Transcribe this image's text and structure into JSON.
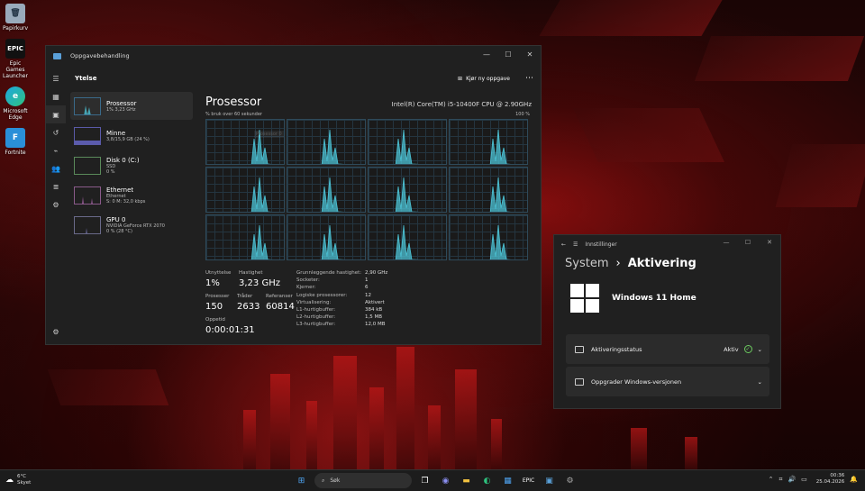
{
  "desktop": {
    "icons": [
      {
        "label": "Papirkurv"
      },
      {
        "label": "Epic Games Launcher"
      },
      {
        "label": "Microsoft Edge"
      },
      {
        "label": "Fortnite"
      }
    ]
  },
  "taskmanager": {
    "window_title": "Oppgavebehandling",
    "section": "Ytelse",
    "new_task": "Kjør ny oppgave",
    "list": [
      {
        "name": "Prosessor",
        "sub1": "1% 3,23 GHz",
        "sub2": ""
      },
      {
        "name": "Minne",
        "sub1": "3,8/15,9 GB (24 %)",
        "sub2": ""
      },
      {
        "name": "Disk 0 (C:)",
        "sub1": "SSD",
        "sub2": "0 %"
      },
      {
        "name": "Ethernet",
        "sub1": "Ethernet",
        "sub2": "S: 0 M: 32,0 kbps"
      },
      {
        "name": "GPU 0",
        "sub1": "NVIDIA GeForce RTX 2070",
        "sub2": "0 % (28 °C)"
      }
    ],
    "title": "Prosessor",
    "cpu_name": "Intel(R) Core(TM) i5-10400F CPU @ 2.90GHz",
    "usage_label": "% bruk over 60 sekunder",
    "usage_max": "100 %",
    "tooltip": "Prosessor 0",
    "stats": {
      "utilization_label": "Utnyttelse",
      "utilization": "1%",
      "speed_label": "Hastighet",
      "speed": "3,23 GHz",
      "processes_label": "Prosesser",
      "processes": "150",
      "threads_label": "Tråder",
      "threads": "2633",
      "handles_label": "Referanser",
      "handles": "60814",
      "uptime_label": "Oppetid",
      "uptime": "0:00:01:31"
    },
    "specs": [
      {
        "k": "Grunnleggende hastighet:",
        "v": "2,90 GHz"
      },
      {
        "k": "Socketer:",
        "v": "1"
      },
      {
        "k": "Kjerner:",
        "v": "6"
      },
      {
        "k": "Logiske prosessorer:",
        "v": "12"
      },
      {
        "k": "Virtualisering:",
        "v": "Aktivert"
      },
      {
        "k": "L1-hurtigbuffer:",
        "v": "384 kB"
      },
      {
        "k": "L2-hurtigbuffer:",
        "v": "1,5 MB"
      },
      {
        "k": "L3-hurtigbuffer:",
        "v": "12,0 MB"
      }
    ]
  },
  "settings": {
    "window_title": "Innstillinger",
    "crumb_root": "System",
    "crumb_sep": "›",
    "crumb_page": "Aktivering",
    "edition": "Windows 11 Home",
    "status_label": "Aktiveringsstatus",
    "status_value": "Aktiv",
    "upgrade_label": "Oppgrader Windows-versjonen"
  },
  "taskbar": {
    "temp": "6°C",
    "weather": "Skyet",
    "search": "Søk",
    "time": "00:36",
    "date": "25.04.2026"
  },
  "colors": {
    "accent": "#4cc2d4",
    "graph_border": "#2e4a5a"
  }
}
